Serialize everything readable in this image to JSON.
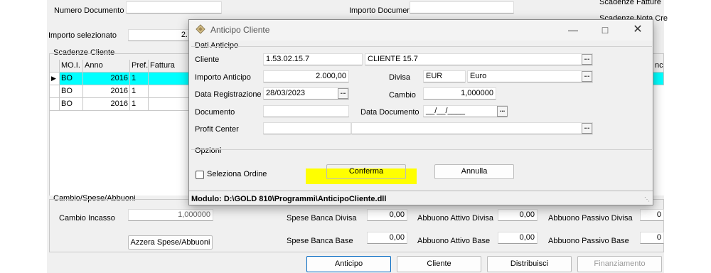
{
  "bg": {
    "numero_documento_label": "Numero Documento",
    "importo_documento_label": "Importo Documento",
    "scadenze_fatture": "Scadenze Fatture",
    "scadenze_nota_cre": "Scadenze Nota Cre",
    "importo_selezionato_label": "Importo selezionato",
    "importo_selezionato_value": "2.",
    "scadenze_cliente_label": "Scadenze Cliente",
    "grid": {
      "headers": [
        "MO.I.",
        "Anno",
        "Pref.",
        "Fattura"
      ],
      "right_header": "nca",
      "rows": [
        [
          "BO",
          "2016",
          "1",
          ""
        ],
        [
          "BO",
          "2016",
          "1",
          ""
        ],
        [
          "BO",
          "2016",
          "1",
          ""
        ]
      ]
    },
    "cambio_spese_abbuoni_label": "Cambio/Spese/Abbuoni",
    "cambio_incasso_label": "Cambio Incasso",
    "cambio_incasso_value": "1,000000",
    "azzera_button": "Azzera Spese/Abbuoni",
    "spese_banca_divisa_label": "Spese Banca Divisa",
    "spese_banca_divisa_value": "0,00",
    "spese_banca_base_label": "Spese Banca Base",
    "spese_banca_base_value": "0,00",
    "abbuono_attivo_divisa_label": "Abbuono Attivo Divisa",
    "abbuono_attivo_divisa_value": "0,00",
    "abbuono_attivo_base_label": "Abbuono Attivo Base",
    "abbuono_attivo_base_value": "0,00",
    "abbuono_passivo_divisa_label": "Abbuono Passivo Divisa",
    "abbuono_passivo_divisa_value": "0",
    "abbuono_passivo_base_label": "Abbuono Passivo Base",
    "abbuono_passivo_base_value": "0",
    "buttons": {
      "anticipo": "Anticipo",
      "cliente": "Cliente",
      "distribuisci": "Distribuisci",
      "finanziamento": "Finanziamento"
    }
  },
  "dialog": {
    "title": "Anticipo Cliente",
    "dati_anticipo_label": "Dati Anticipo",
    "cliente_label": "Cliente",
    "cliente_code": "1.53.02.15.7",
    "cliente_name": "CLIENTE 15.7",
    "importo_anticipo_label": "Importo Anticipo",
    "importo_anticipo_value": "2.000,00",
    "divisa_label": "Divisa",
    "divisa_code": "EUR",
    "divisa_name": "Euro",
    "data_registrazione_label": "Data Registrazione",
    "data_registrazione_value": "28/03/2023",
    "cambio_label": "Cambio",
    "cambio_value": "1,000000",
    "documento_label": "Documento",
    "documento_value": "",
    "data_documento_label": "Data Documento",
    "data_documento_value": "__/__/____",
    "profit_center_label": "Profit Center",
    "opzioni_label": "Opzioni",
    "seleziona_ordine_label": "Seleziona Ordine",
    "seleziona_ordine_checked": false,
    "conferma_button": "Conferma",
    "annulla_button": "Annulla",
    "status": "Modulo: D:\\GOLD 810\\Programmi\\AnticipoCliente.dll",
    "dots_glyph": "..."
  },
  "colors": {
    "row_selected": "#00ffff",
    "highlight": "#ffff00",
    "dialog_bg": "#f0f0f0"
  }
}
